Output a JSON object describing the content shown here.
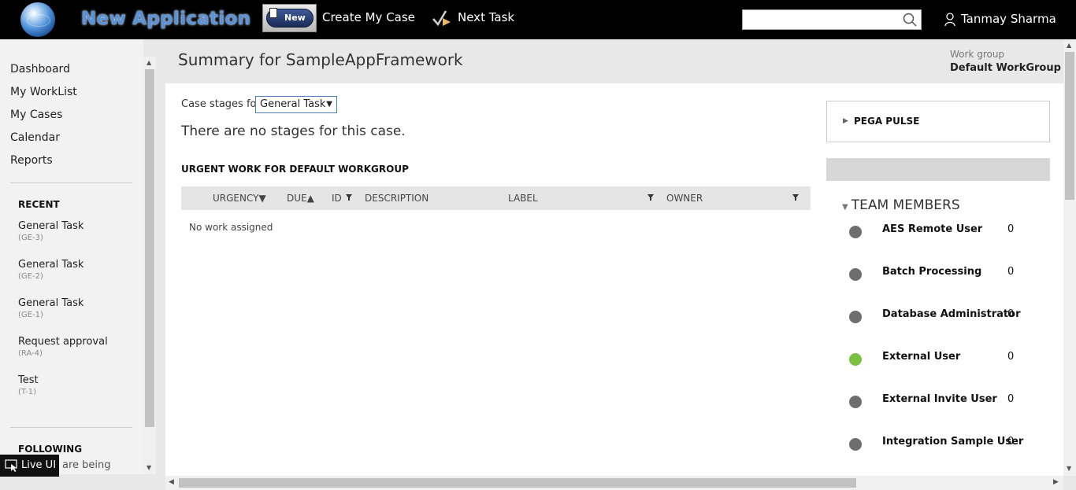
{
  "header": {
    "app_title": "New Application",
    "new_button": "New",
    "create_my_case": "Create My Case",
    "next_task": "Next Task",
    "search_placeholder": "",
    "user_name": "Tanmay Sharma"
  },
  "sidebar": {
    "nav": [
      "Dashboard",
      "My WorkList",
      "My Cases",
      "Calendar",
      "Reports"
    ],
    "recent_heading": "RECENT",
    "recent": [
      {
        "title": "General Task",
        "id": "(GE-3)"
      },
      {
        "title": "General Task",
        "id": "(GE-2)"
      },
      {
        "title": "General Task",
        "id": "(GE-1)"
      },
      {
        "title": "Request approval",
        "id": "(RA-4)"
      },
      {
        "title": "Test",
        "id": "(T-1)"
      }
    ],
    "following_heading": "FOLLOWING",
    "following_text": "are being",
    "live_ui": "Live UI"
  },
  "main": {
    "title": "Summary for SampleAppFramework",
    "workgroup_label": "Work group",
    "workgroup_value": "Default WorkGroup",
    "case_stages_label": "Case stages for",
    "case_stages_value": "General Task",
    "no_stages": "There are no stages for this case.",
    "urgent_title": "URGENT WORK FOR DEFAULT WORKGROUP",
    "columns": {
      "urgency": "URGENCY",
      "due": "DUE",
      "id": "ID",
      "description": "DESCRIPTION",
      "label": "LABEL",
      "owner": "OWNER"
    },
    "no_work": "No work assigned"
  },
  "right_panel": {
    "pulse": "PEGA PULSE",
    "team_heading": "TEAM MEMBERS",
    "members": [
      {
        "name": "AES Remote User",
        "count": "0",
        "status": "offline"
      },
      {
        "name": "Batch Processing",
        "count": "0",
        "status": "offline"
      },
      {
        "name": "Database Administrator",
        "count": "0",
        "status": "offline"
      },
      {
        "name": "External User",
        "count": "0",
        "status": "online"
      },
      {
        "name": "External Invite User",
        "count": "0",
        "status": "offline"
      },
      {
        "name": "Integration Sample User",
        "count": "0",
        "status": "offline"
      }
    ]
  },
  "colors": {
    "topbar": "#000000",
    "online": "#7ac142",
    "offline": "#6e6e6e",
    "select_border": "#4a7fc1"
  }
}
